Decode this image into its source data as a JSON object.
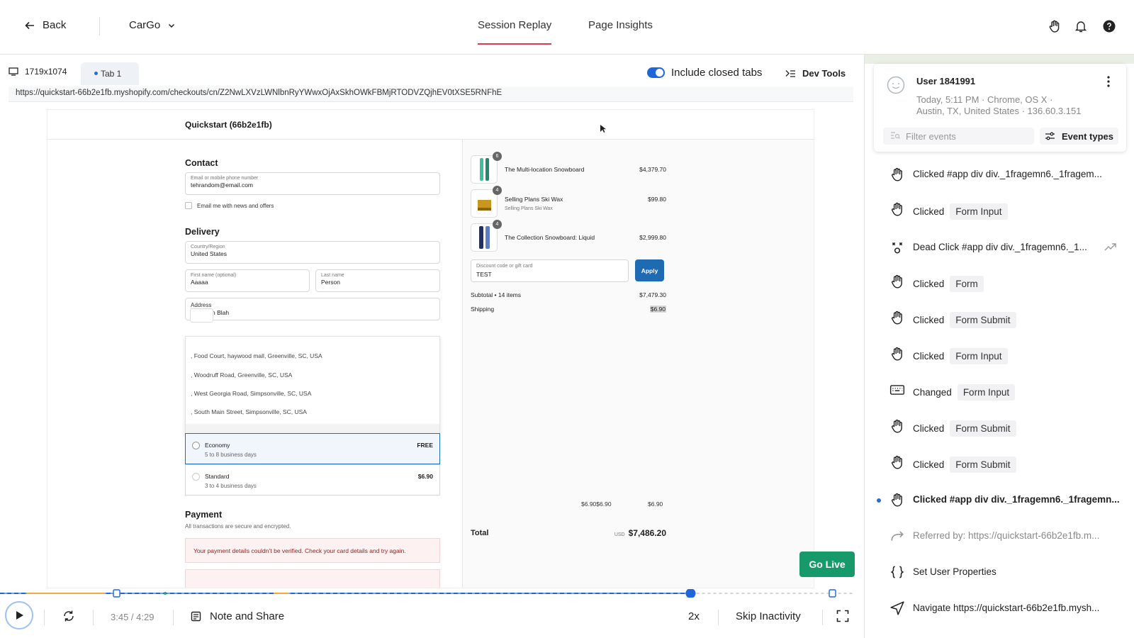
{
  "header": {
    "back_label": "Back",
    "app_name": "CarGo",
    "tabs": [
      {
        "label": "Session Replay"
      },
      {
        "label": "Page Insights"
      }
    ]
  },
  "viewer": {
    "resolution": "1719x1074",
    "tab_label": "Tab 1",
    "include_closed_tabs": "Include closed tabs",
    "dev_tools": "Dev Tools",
    "url": "https://quickstart-66b2e1fb.myshopify.com/checkouts/cn/Z2NwLXVzLWNlbnRyYWwxOjAxSkhOWkFBMjRTODVZQjhEV0tXSE5RNFhE"
  },
  "checkout": {
    "store_name": "Quickstart (66b2e1fb)",
    "contact_heading": "Contact",
    "email_label": "Email or mobile phone number",
    "email_value": "tehrandom@email.com",
    "news_label": "Email me with news and offers",
    "delivery_heading": "Delivery",
    "country_label": "Country/Region",
    "country_value": "United States",
    "first_name_label": "First name (optional)",
    "first_name_value": "Aaaaa",
    "last_name_label": "Last name",
    "last_name_value": "Person",
    "address_label": "Address",
    "address_value": "n Blah",
    "suggestions": [
      ", Food Court, haywood mall, Greenville, SC, USA",
      ", Woodruff Road, Greenville, SC, USA",
      ", West Georgia Road, Simpsonville, SC, USA",
      ", South Main Street, Simpsonville, SC, USA"
    ],
    "shipping_options": [
      {
        "name": "Economy",
        "days": "5 to 8 business days",
        "price": "FREE"
      },
      {
        "name": "Standard",
        "days": "3 to 4 business days",
        "price": "$6.90"
      }
    ],
    "payment_heading": "Payment",
    "payment_sub": "All transactions are secure and encrypted.",
    "payment_error": "Your payment details couldn’t be verified. Check your card details and try again.",
    "products": [
      {
        "name": "The Multi-location Snowboard",
        "sub": "",
        "price": "$4,379.70",
        "qty": "6"
      },
      {
        "name": "Selling Plans Ski Wax",
        "sub": "Selling Plans Ski Wax",
        "price": "$99.80",
        "qty": "4"
      },
      {
        "name": "The Collection Snowboard: Liquid",
        "sub": "",
        "price": "$2,999.80",
        "qty": "4"
      }
    ],
    "discount_label": "Discount code or gift card",
    "discount_value": "TEST",
    "apply_label": "Apply",
    "subtotal_label": "Subtotal • 14 items",
    "subtotal_value": "$7,479.30",
    "shipping_label": "Shipping",
    "shipping_value": "$6.90",
    "extra_left": "$6.90$6.90",
    "extra_right": "$6.90",
    "total_label": "Total",
    "currency": "USD",
    "total_value": "$7,486.20"
  },
  "go_live": "Go Live",
  "player": {
    "progress": 0.81,
    "time": "3:45 / 4:29",
    "note_share": "Note and Share",
    "speed": "2x",
    "skip": "Skip Inactivity"
  },
  "sidebar": {
    "user_name": "User 1841991",
    "meta_line1": "Today, 5:11 PM  ·  Chrome, OS X  ·",
    "meta_line2": "Austin, TX, United States  ·  136.60.3.151",
    "filter_placeholder": "Filter events",
    "event_types": "Event types",
    "events": [
      {
        "icon": "click-icon",
        "text": "Clicked #app div div._1fragemn6._1fragem...",
        "tag": ""
      },
      {
        "icon": "click-icon",
        "text": "Clicked",
        "tag": "Form Input"
      },
      {
        "icon": "dead-click-icon",
        "text": "Dead Click #app div div._1fragemn6._1...",
        "tag": ""
      },
      {
        "icon": "click-icon",
        "text": "Clicked",
        "tag": "Form"
      },
      {
        "icon": "click-icon",
        "text": "Clicked",
        "tag": "Form Submit"
      },
      {
        "icon": "click-icon",
        "text": "Clicked",
        "tag": "Form Input"
      },
      {
        "icon": "keyboard-icon",
        "text": "Changed",
        "tag": "Form Input"
      },
      {
        "icon": "click-icon",
        "text": "Clicked",
        "tag": "Form Submit"
      },
      {
        "icon": "click-icon",
        "text": "Clicked",
        "tag": "Form Submit"
      },
      {
        "icon": "click-icon",
        "text": "Clicked #app div div._1fragemn6._1fragemn...",
        "tag": ""
      },
      {
        "icon": "referrer-icon",
        "text": "Referred by: https://quickstart-66b2e1fb.m...",
        "tag": ""
      },
      {
        "icon": "braces-icon",
        "text": "Set User Properties",
        "tag": ""
      },
      {
        "icon": "navigate-icon",
        "text": "Navigate https://quickstart-66b2e1fb.mysh...",
        "tag": ""
      }
    ]
  },
  "colors": {
    "accent": "#e0384f",
    "primary_blue": "#1f66db",
    "go_live_green": "#179a6a",
    "apply_blue": "#1e6ab3"
  }
}
